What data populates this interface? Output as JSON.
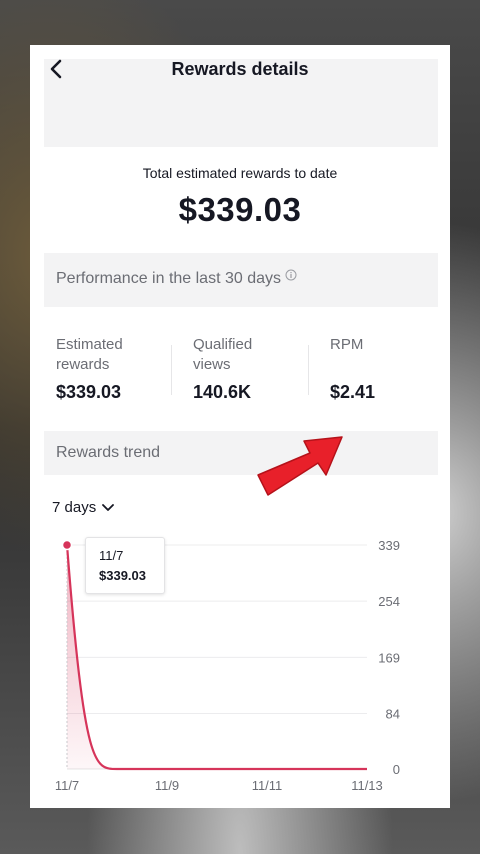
{
  "header": {
    "title": "Rewards details",
    "back_icon": "chevron-left-icon"
  },
  "summary": {
    "label": "Total estimated rewards to date",
    "value": "$339.03"
  },
  "performance": {
    "title": "Performance in the last 30 days",
    "info_icon": "info-icon",
    "metrics": [
      {
        "label_line1": "Estimated",
        "label_line2": "rewards",
        "value": "$339.03"
      },
      {
        "label_line1": "Qualified",
        "label_line2": "views",
        "value": "140.6K"
      },
      {
        "label_line1": "RPM",
        "label_line2": "",
        "value": "$2.41"
      }
    ]
  },
  "trend": {
    "title": "Rewards trend",
    "range_label": "7 days",
    "tooltip": {
      "date": "11/7",
      "value": "$339.03"
    }
  },
  "colors": {
    "accent": "#d6345a",
    "arrow": "#e8202a",
    "text": "#161823",
    "muted": "#6b6d74",
    "panel": "#f3f3f4"
  },
  "chart_data": {
    "type": "area",
    "x": [
      "11/7",
      "11/8",
      "11/9",
      "11/10",
      "11/11",
      "11/12",
      "11/13"
    ],
    "values": [
      339,
      0,
      0,
      0,
      0,
      0,
      0
    ],
    "xticks": [
      "11/7",
      "11/9",
      "11/11",
      "11/13"
    ],
    "yticks": [
      0,
      84,
      169,
      254,
      339
    ],
    "ylim": [
      0,
      339
    ],
    "grid": true,
    "y_axis_side": "right",
    "title": "",
    "xlabel": "",
    "ylabel": ""
  }
}
